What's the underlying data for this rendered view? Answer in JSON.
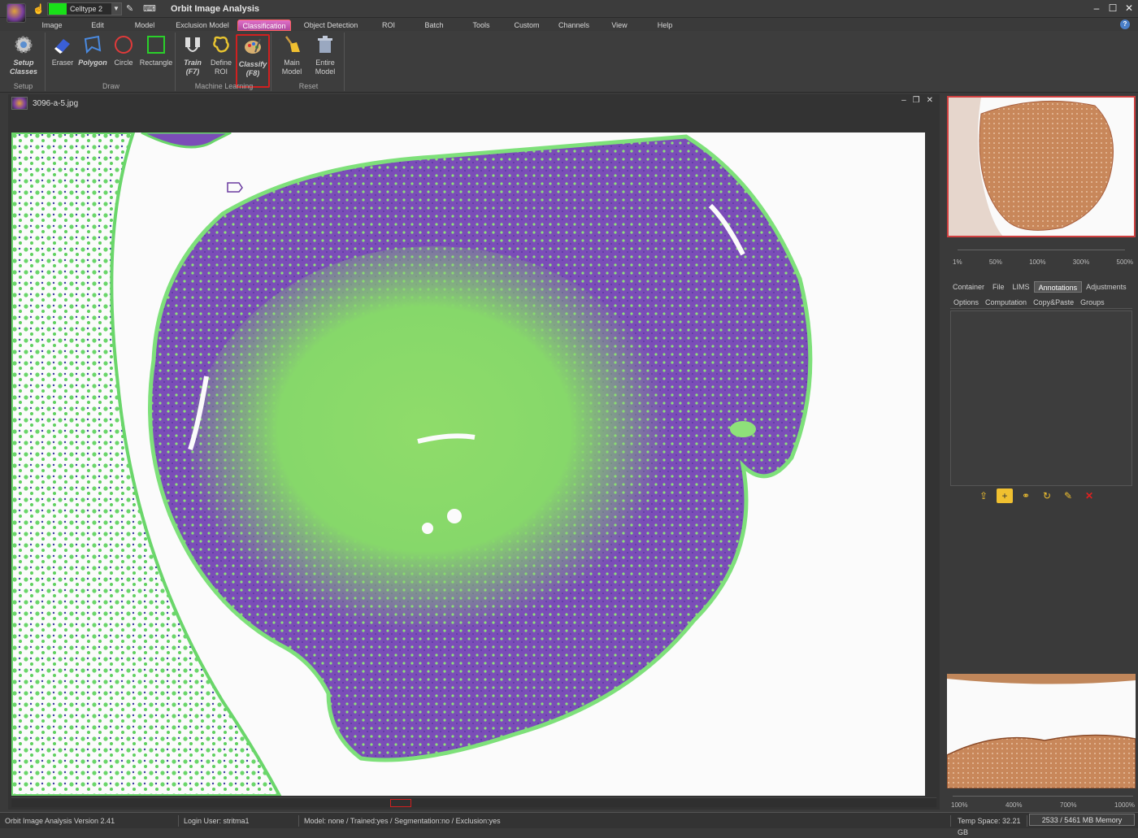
{
  "titlebar": {
    "title": "Orbit Image Analysis",
    "class_combo": "Celltype 2",
    "class_color": "#19e019"
  },
  "menu": [
    "Image",
    "Edit",
    "Model",
    "Exclusion Model",
    "Classification",
    "Object Detection",
    "ROI",
    "Batch",
    "Tools",
    "Custom",
    "Channels",
    "View",
    "Help"
  ],
  "ribbon": {
    "setup": {
      "label1": "Setup",
      "label2": "Classes",
      "group": "Setup"
    },
    "draw": {
      "eraser": "Eraser",
      "polygon": "Polygon",
      "circle": "Circle",
      "rectangle": "Rectangle",
      "group": "Draw"
    },
    "ml": {
      "train1": "Train",
      "train2": "(F7)",
      "define1": "Define",
      "define2": "ROI",
      "classify1": "Classify",
      "classify2": "(F8)",
      "group": "Machine Learning"
    },
    "reset": {
      "main1": "Main",
      "main2": "Model",
      "entire1": "Entire",
      "entire2": "Model",
      "group": "Reset"
    }
  },
  "document": {
    "filename": "3096-a-5.jpg"
  },
  "zoom_top": [
    "1%",
    "50%",
    "100%",
    "300%",
    "500%"
  ],
  "panel_tabs": [
    "Container",
    "File",
    "LIMS",
    "Annotations",
    "Adjustments"
  ],
  "panel_active": "Annotations",
  "sub_tabs": [
    "Options",
    "Computation",
    "Copy&Paste",
    "Groups"
  ],
  "zoom_bottom": [
    "100%",
    "400%",
    "700%",
    "1000%"
  ],
  "status": {
    "version": "Orbit Image Analysis Version 2.41",
    "user": "Login User: stritma1",
    "model": "Model: none / Trained:yes / Segmentation:no / Exclusion:yes",
    "temp": "Temp Space: 32.21 GB",
    "memory": "2533 / 5461 MB Memory"
  }
}
